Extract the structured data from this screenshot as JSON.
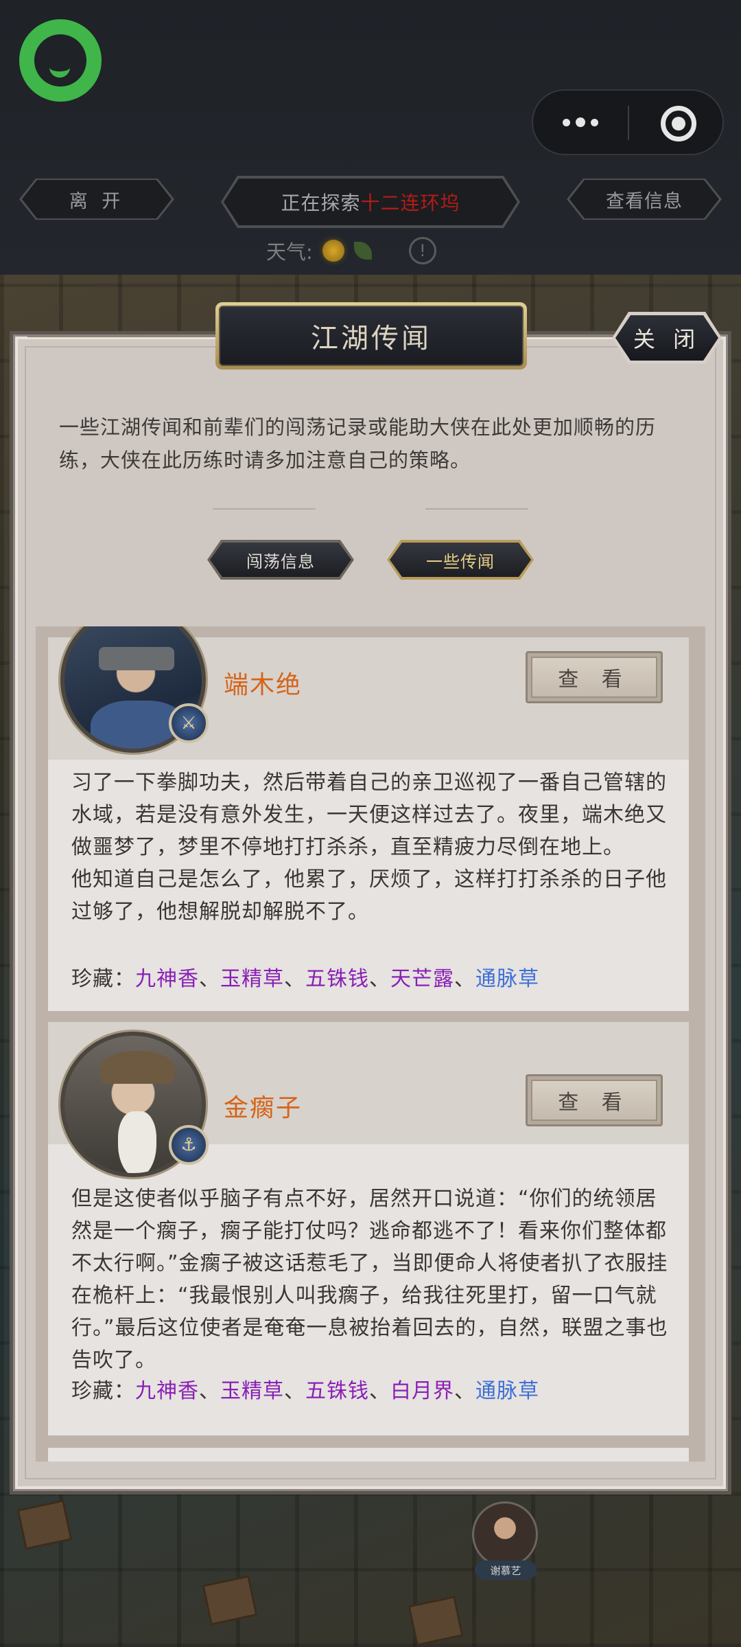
{
  "header": {
    "leave_label": "离 开",
    "exploring_prefix": "正在探索",
    "exploring_location": "十二连环坞",
    "view_info_label": "查看信息",
    "weather_label": "天气:",
    "warn_glyph": "!"
  },
  "panel": {
    "title": "江湖传闻",
    "close_label": "关 闭",
    "intro": "一些江湖传闻和前辈们的闯荡记录或能助大侠在此处更加顺畅的历练，大侠在此历练时请多加注意自己的策略。",
    "tabs": [
      {
        "label": "闯荡信息",
        "active": false
      },
      {
        "label": "一些传闻",
        "active": true
      }
    ]
  },
  "cards": [
    {
      "name": "端木绝",
      "view_label": "查 看",
      "story": "习了一下拳脚功夫，然后带着自己的亲卫巡视了一番自己管辖的水域，若是没有意外发生，一天便这样过去了。夜里，端木绝又做噩梦了，梦里不停地打打杀杀，直至精疲力尽倒在地上。\n他知道自己是怎么了，他累了，厌烦了，这样打打杀杀的日子他过够了，他想解脱却解脱不了。",
      "treasure_label": "珍藏：",
      "treasures": [
        {
          "name": "九神香",
          "color": "#8a1fb5"
        },
        {
          "name": "玉精草",
          "color": "#8a1fb5"
        },
        {
          "name": "五铢钱",
          "color": "#8a1fb5"
        },
        {
          "name": "天芒露",
          "color": "#8a1fb5"
        },
        {
          "name": "通脉草",
          "color": "#3f6fd6"
        }
      ]
    },
    {
      "name": "金瘸子",
      "view_label": "查 看",
      "story": "但是这使者似乎脑子有点不好，居然开口说道：“你们的统领居然是一个瘸子，瘸子能打仗吗？逃命都逃不了！看来你们整体都不太行啊。”金瘸子被这话惹毛了，当即便命人将使者扒了衣服挂在桅杆上：“我最恨别人叫我瘸子，给我往死里打，留一口气就行。”最后这位使者是奄奄一息被抬着回去的，自然，联盟之事也告吹了。",
      "treasure_label": "珍藏：",
      "treasures": [
        {
          "name": "九神香",
          "color": "#8a1fb5"
        },
        {
          "name": "玉精草",
          "color": "#8a1fb5"
        },
        {
          "name": "五铢钱",
          "color": "#8a1fb5"
        },
        {
          "name": "白月界",
          "color": "#8a1fb5"
        },
        {
          "name": "通脉草",
          "color": "#3f6fd6"
        }
      ]
    }
  ],
  "scene": {
    "npc_name": "谢慕艺"
  },
  "colors": {
    "location_red": "#b31c16",
    "name_orange": "#d4651a",
    "treasure_purple": "#8a1fb5",
    "treasure_blue": "#3f6fd6",
    "mini_program_green": "#3fb54a"
  }
}
